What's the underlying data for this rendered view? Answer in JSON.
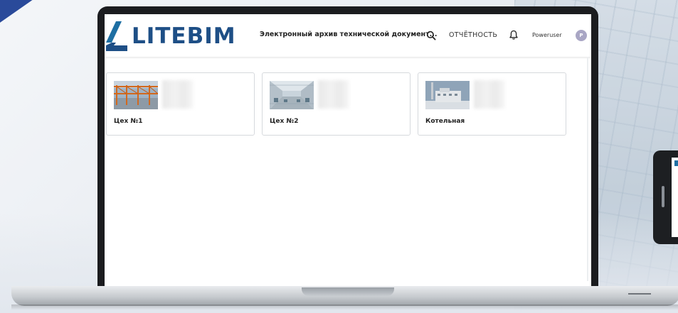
{
  "app": {
    "logo_text": "LITEBIM",
    "title": "Электронный архив технической документ...",
    "report_label": "ОТЧЁТНОСТЬ",
    "user_name": "Poweruser",
    "avatar_initial": "P"
  },
  "icons": {
    "search": "search-icon",
    "bell": "bell-icon",
    "logo": "litebim-logo-icon"
  },
  "colors": {
    "brand_blue": "#1e4f86",
    "brand_accent": "#1e6fa3",
    "avatar_bg": "#a9a6c4"
  },
  "cards": [
    {
      "label": "Цех №1",
      "image": "steel-frame-workshop-photo"
    },
    {
      "label": "Цех №2",
      "image": "factory-hall-interior-photo"
    },
    {
      "label": "Котельная",
      "image": "boiler-house-exterior-photo"
    }
  ]
}
